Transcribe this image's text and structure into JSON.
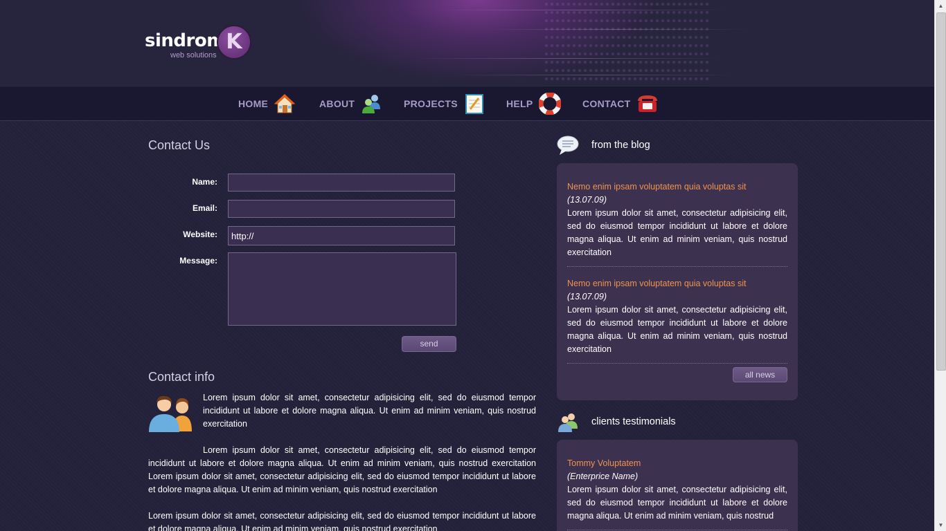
{
  "logo": {
    "name": "sindrom",
    "letter": "K",
    "tagline": "web solutions"
  },
  "nav": [
    {
      "label": "HOME",
      "icon": "house-icon"
    },
    {
      "label": "ABOUT",
      "icon": "users-icon"
    },
    {
      "label": "PROJECTS",
      "icon": "notepad-icon"
    },
    {
      "label": "HELP",
      "icon": "lifebuoy-icon"
    },
    {
      "label": "CONTACT",
      "icon": "telephone-icon"
    }
  ],
  "contact_form": {
    "title": "Contact Us",
    "name_label": "Name:",
    "email_label": "Email:",
    "website_label": "Website:",
    "website_value": "http://",
    "message_label": "Message:",
    "send_label": "send"
  },
  "contact_info": {
    "title": "Contact info",
    "para1": "Lorem ipsum dolor sit amet, consectetur adipisicing elit, sed do eiusmod tempor incididunt ut labore et dolore magna aliqua. Ut enim ad minim veniam, quis nostrud exercitation",
    "para2": "Lorem ipsum dolor sit amet, consectetur adipisicing elit, sed do eiusmod tempor incididunt ut labore et dolore magna aliqua. Ut enim ad minim veniam, quis nostrud exercitation Lorem ipsum dolor sit amet, consectetur adipisicing elit, sed do eiusmod tempor incididunt ut labore et dolore magna aliqua. Ut enim ad minim veniam, quis nostrud exercitation",
    "para3": "Lorem ipsum dolor sit amet, consectetur adipisicing elit, sed do eiusmod tempor incididunt ut labore et dolore magna aliqua. Ut enim ad minim veniam, quis nostrud exercitation"
  },
  "blog": {
    "title": "from the blog",
    "items": [
      {
        "title": "Nemo enim ipsam voluptatem quia voluptas sit",
        "date": "(13.07.09)",
        "text": "Lorem ipsum dolor sit amet, consectetur adipisicing elit, sed do eiusmod tempor incididunt ut labore et dolore magna aliqua. Ut enim ad minim veniam, quis nostrud exercitation"
      },
      {
        "title": "Nemo enim ipsam voluptatem quia voluptas sit",
        "date": "(13.07.09)",
        "text": "Lorem ipsum dolor sit amet, consectetur adipisicing elit, sed do eiusmod tempor incididunt ut labore et dolore magna aliqua. Ut enim ad minim veniam, quis nostrud exercitation"
      }
    ],
    "all_news_label": "all news"
  },
  "testimonials": {
    "title": "clients testimonials",
    "items": [
      {
        "name": "Tommy Voluptatem",
        "company": "(Enterprice Name)",
        "text": "Lorem ipsum dolor sit amet, consectetur adipisicing elit, sed do eiusmod tempor incididunt ut labore et dolore magna aliqua. Ut enim ad minim veniam, quis nostrud"
      }
    ]
  },
  "colors": {
    "accent": "#f0924e",
    "nav_text": "#a89bc6",
    "panel": "#3c3250"
  }
}
